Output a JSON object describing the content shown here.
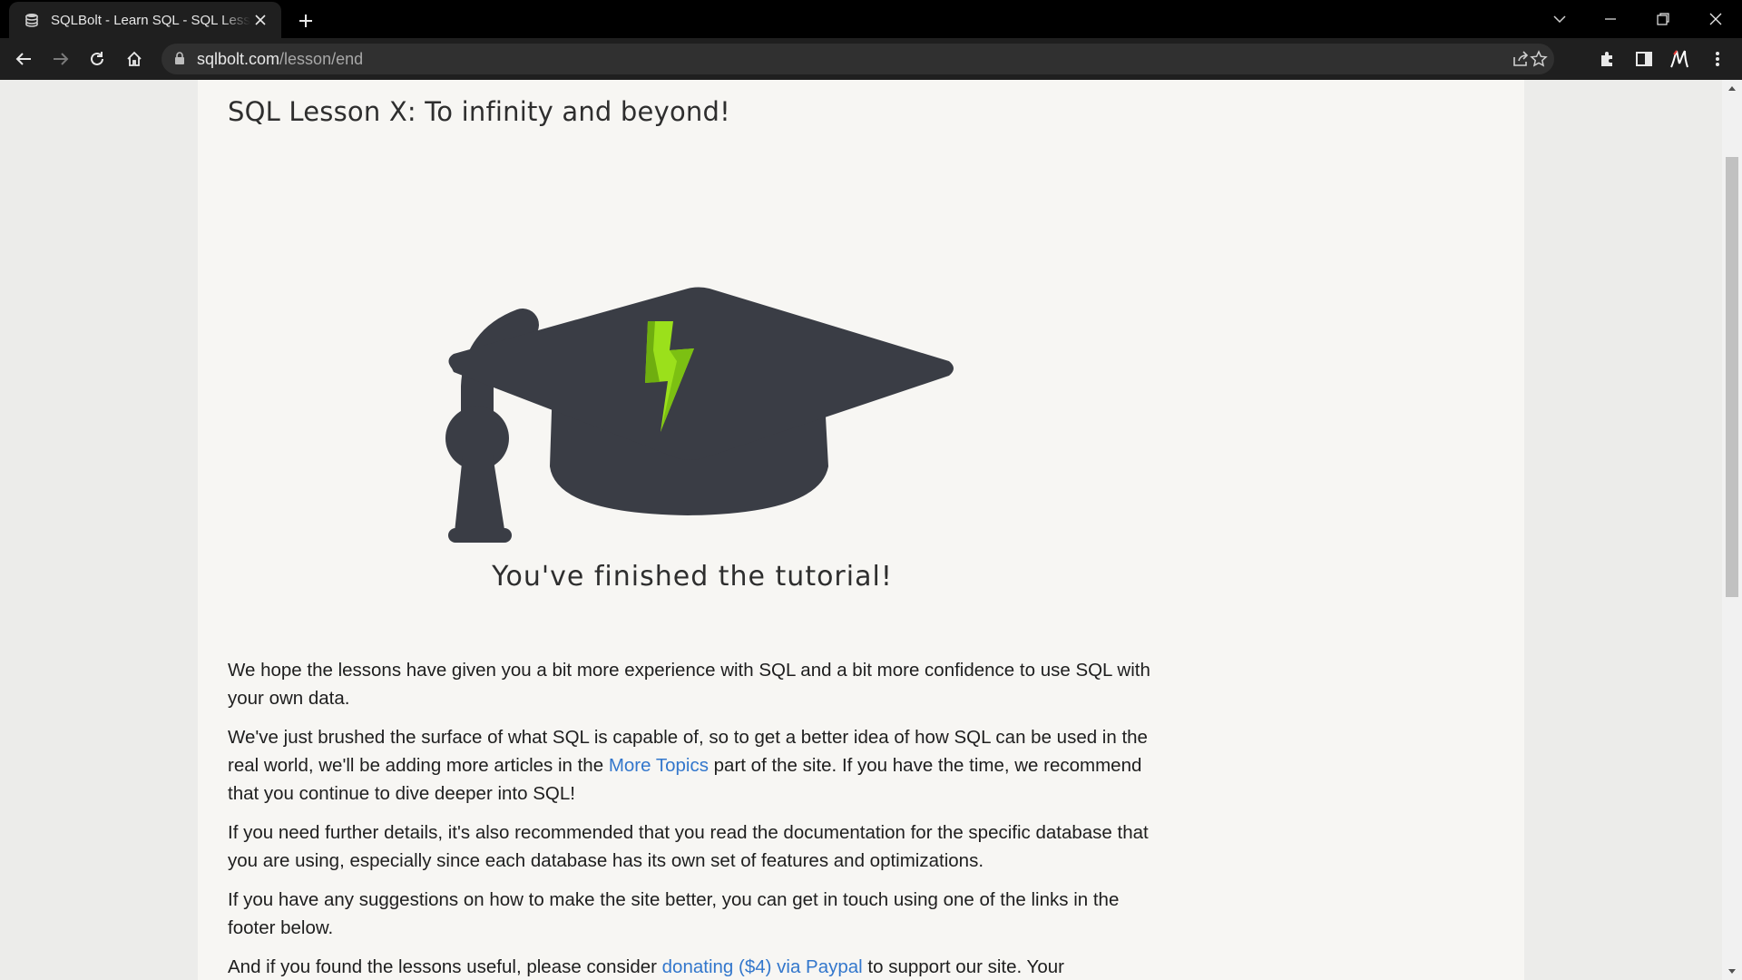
{
  "browser": {
    "tab_title": "SQLBolt - Learn SQL - SQL Lesson X: To infinity and beyond!",
    "url_host": "sqlbolt.com",
    "url_path": "/lesson/end"
  },
  "page": {
    "lesson_title": "SQL Lesson X: To infinity and beyond!",
    "finished_text": "You've finished the tutorial!",
    "p1": "We hope the lessons have given you a bit more experience with SQL and a bit more confidence to use SQL with your own data.",
    "p2_before": "We've just brushed the surface of what SQL is capable of, so to get a better idea of how SQL can be used in the real world, we'll be adding more articles in the ",
    "p2_link": "More Topics",
    "p2_after": " part of the site. If you have the time, we recommend that you continue to dive deeper into SQL!",
    "p3": "If you need further details, it's also recommended that you read the documentation for the specific database that you are using, especially since each database has its own set of features and optimizations.",
    "p4": "If you have any suggestions on how to make the site better, you can get in touch using one of the links in the footer below.",
    "p5_before": "And if you found the lessons useful, please consider ",
    "p5_link": "donating ($4) via Paypal",
    "p5_after": " to support our site. Your"
  },
  "colors": {
    "cap": "#3a3d45",
    "bolt_light": "#9be01b",
    "bolt_dark": "#6fae0f",
    "link": "#3377cc"
  }
}
